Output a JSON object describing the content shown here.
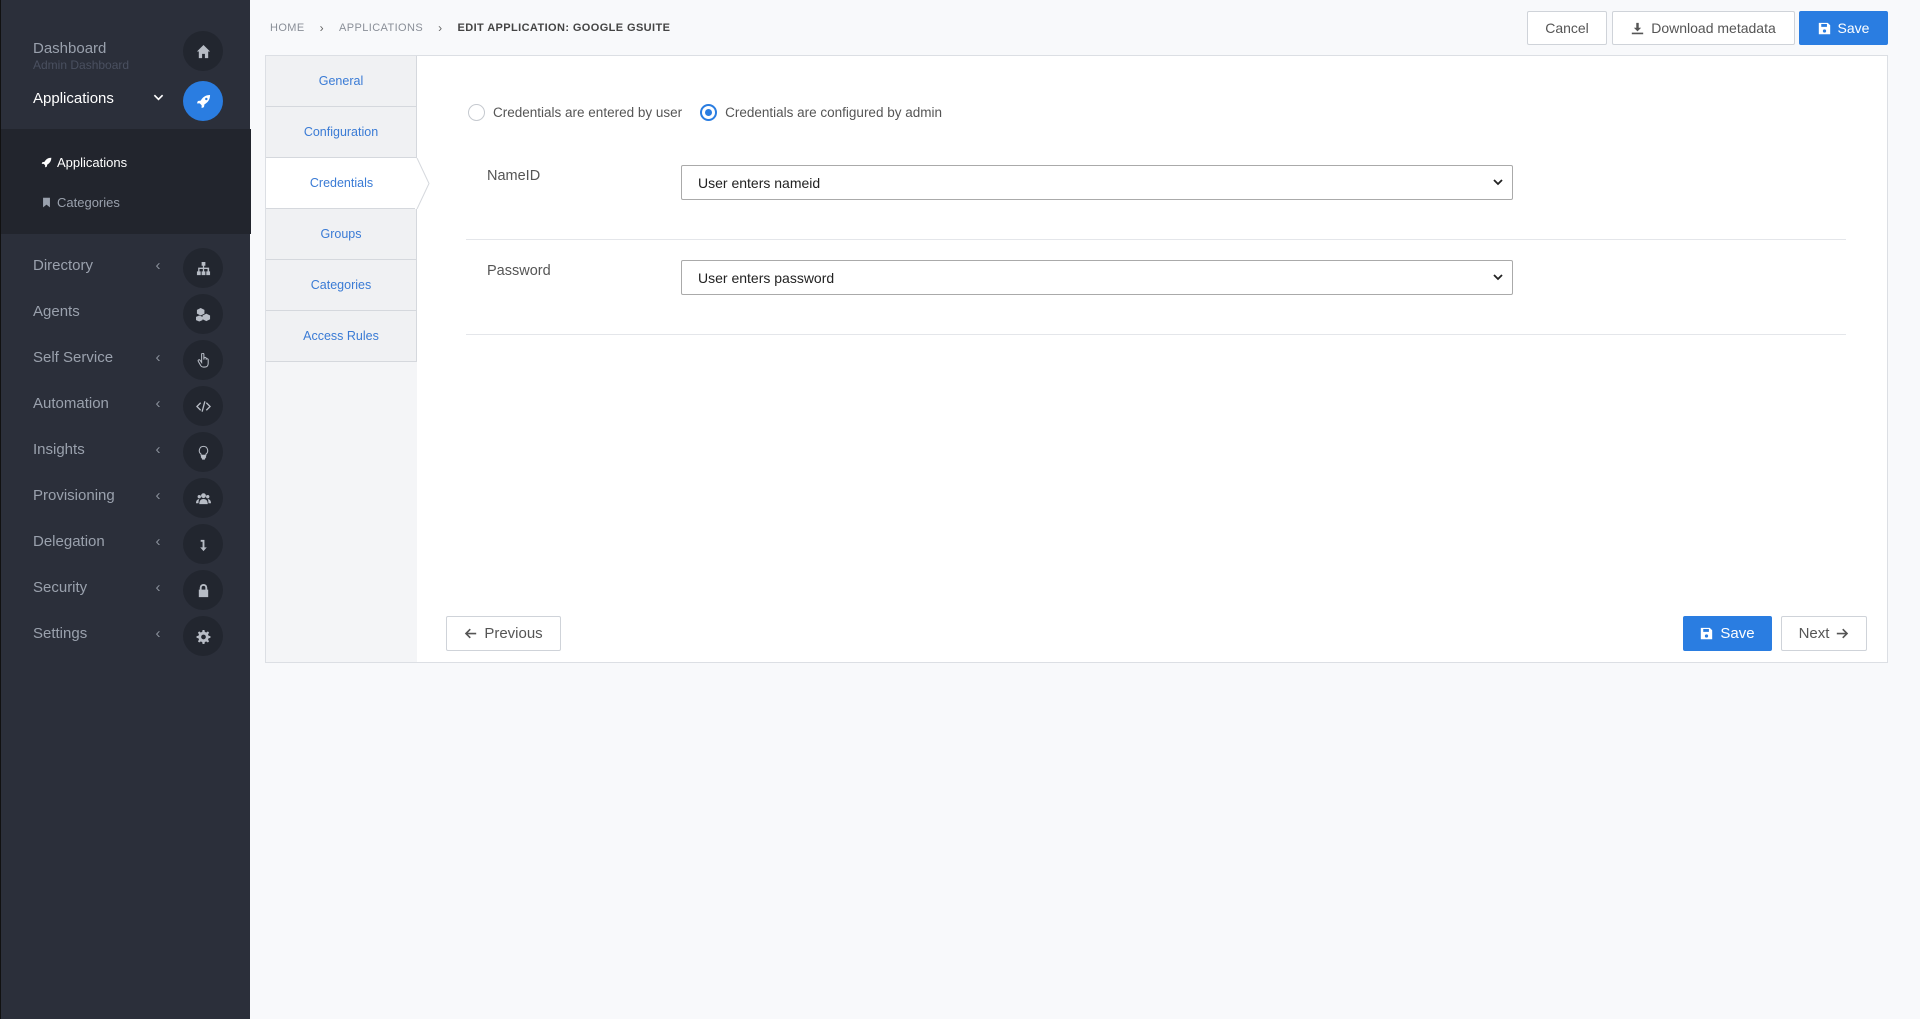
{
  "sidebar": {
    "dashboard": {
      "label": "Dashboard",
      "sub": "Admin Dashboard"
    },
    "applications": {
      "label": "Applications"
    },
    "submenu": [
      {
        "label": "Applications"
      },
      {
        "label": "Categories"
      }
    ],
    "items": [
      {
        "label": "Directory",
        "icon": "sitemap-icon"
      },
      {
        "label": "Agents",
        "icon": "cubes-icon"
      },
      {
        "label": "Self Service",
        "icon": "pointer-hand-icon"
      },
      {
        "label": "Automation",
        "icon": "code-icon"
      },
      {
        "label": "Insights",
        "icon": "lightbulb-icon"
      },
      {
        "label": "Provisioning",
        "icon": "users-icon"
      },
      {
        "label": "Delegation",
        "icon": "level-down-icon"
      },
      {
        "label": "Security",
        "icon": "lock-icon"
      },
      {
        "label": "Settings",
        "icon": "gear-icon"
      }
    ],
    "colors": {
      "background": "#2b2f3a",
      "accent": "#2a7de1"
    }
  },
  "breadcrumb": {
    "home": "HOME",
    "applications": "APPLICATIONS",
    "current": "EDIT APPLICATION: GOOGLE GSUITE"
  },
  "header": {
    "cancel_label": "Cancel",
    "download_label": "Download metadata",
    "save_label": "Save"
  },
  "tabs": [
    {
      "label": "General"
    },
    {
      "label": "Configuration"
    },
    {
      "label": "Credentials",
      "active": true
    },
    {
      "label": "Groups"
    },
    {
      "label": "Categories"
    },
    {
      "label": "Access Rules"
    }
  ],
  "credentials": {
    "mode_options": [
      {
        "label": "Credentials are entered by user",
        "checked": false
      },
      {
        "label": "Credentials are configured by admin",
        "checked": true
      }
    ],
    "nameid": {
      "label": "NameID",
      "value": "User enters nameid"
    },
    "password": {
      "label": "Password",
      "value": "User enters password"
    }
  },
  "footer": {
    "previous_label": "Previous",
    "save_label": "Save",
    "next_label": "Next"
  }
}
